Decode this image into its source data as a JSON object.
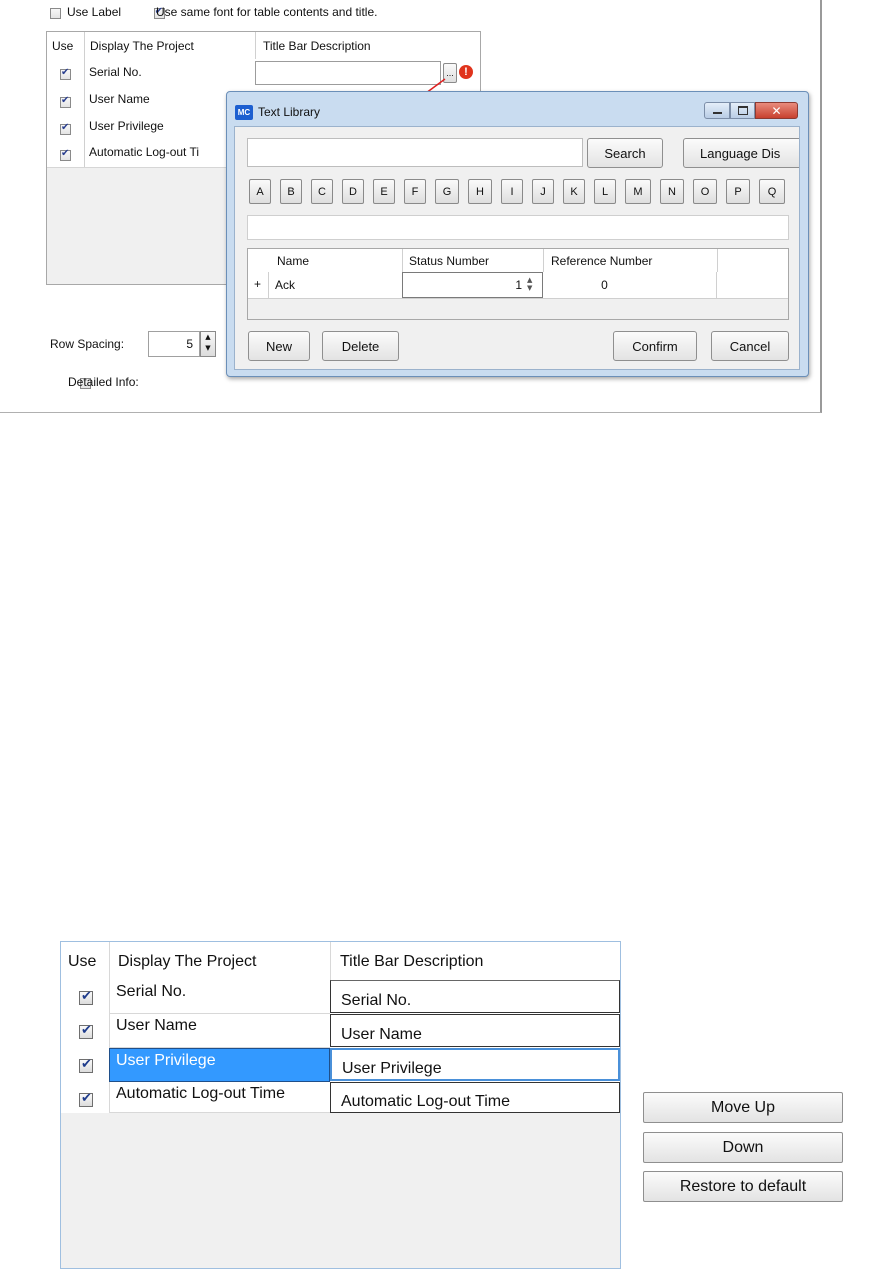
{
  "top_dialog": {
    "use_label": "Use Label",
    "use_label_checked": false,
    "same_font": "Use same font for table contents and title.",
    "same_font_checked": true,
    "table": {
      "headers": [
        "Use",
        "Display The Project",
        "Title Bar Description"
      ],
      "rows": [
        {
          "checked": true,
          "name": "Serial No.",
          "desc": ""
        },
        {
          "checked": true,
          "name": "User Name",
          "desc": ""
        },
        {
          "checked": true,
          "name": "User Privilege",
          "desc": ""
        },
        {
          "checked": true,
          "name": "Automatic Log-out Ti",
          "desc": ""
        }
      ],
      "ellipsis": "...",
      "warning": "!"
    },
    "row_spacing_label": "Row Spacing:",
    "row_spacing_value": "5",
    "detailed_info": "Detailed Info:",
    "detailed_info_checked": false
  },
  "text_library": {
    "app_icon": "MC",
    "title": "Text Library",
    "search_value": "",
    "search_button": "Search",
    "language_button": "Language Dis",
    "letters": [
      "A",
      "B",
      "C",
      "D",
      "E",
      "F",
      "G",
      "H",
      "I",
      "J",
      "K",
      "L",
      "M",
      "N",
      "O",
      "P",
      "Q"
    ],
    "table": {
      "headers": [
        "Name",
        "Status Number",
        "Reference Number"
      ],
      "rows": [
        {
          "expand": "+",
          "name": "Ack",
          "status": "1",
          "reference": "0"
        }
      ]
    },
    "new_button": "New",
    "delete_button": "Delete",
    "confirm_button": "Confirm",
    "cancel_button": "Cancel",
    "accent": "#c9dcf0",
    "close_color": "#d9534f"
  },
  "bottom_panel": {
    "headers": [
      "Use",
      "Display The Project",
      "Title Bar Description"
    ],
    "rows": [
      {
        "checked": true,
        "name": "Serial No.",
        "desc": "Serial No.",
        "selected": false
      },
      {
        "checked": true,
        "name": "User Name",
        "desc": "User Name",
        "selected": false
      },
      {
        "checked": true,
        "name": "User Privilege",
        "desc": "User Privilege",
        "selected": true
      },
      {
        "checked": true,
        "name": "Automatic Log-out Time",
        "desc": "Automatic Log-out Time",
        "selected": false
      }
    ],
    "move_up": "Move Up",
    "down": "Down",
    "restore": "Restore to default",
    "selection_color": "#3399ff"
  }
}
